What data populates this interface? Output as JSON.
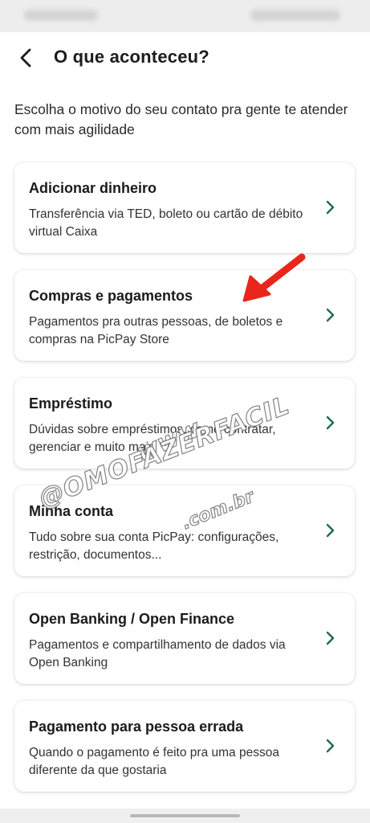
{
  "header": {
    "title": "O que aconteceu?",
    "back_icon": "chevron-left-icon"
  },
  "intro_text": "Escolha o motivo do seu contato pra gente te atender com mais agilidade",
  "options": [
    {
      "title": "Adicionar dinheiro",
      "description": "Transferência via TED, boleto ou cartão de débito virtual Caixa"
    },
    {
      "title": "Compras e pagamentos",
      "description": "Pagamentos pra outras pessoas, de boletos e compras na PicPay Store"
    },
    {
      "title": "Empréstimo",
      "description": "Dúvidas sobre empréstimos, como contratar, gerenciar e muito mais"
    },
    {
      "title": "Minha conta",
      "description": "Tudo sobre sua conta PicPay: configurações, restrição, documentos..."
    },
    {
      "title": "Open Banking / Open Finance",
      "description": "Pagamentos e compartilhamento de dados via Open Banking"
    },
    {
      "title": "Pagamento para pessoa errada",
      "description": "Quando o pagamento é feito pra uma pessoa diferente da que gostaria"
    }
  ],
  "watermark": {
    "line1": "www.",
    "line2": "@OMOFAZERFACIL",
    "line3": ".com.br"
  },
  "colors": {
    "accent_chevron": "#1f6b4f",
    "annotation_arrow": "#e8261b",
    "background": "#ffffff"
  }
}
